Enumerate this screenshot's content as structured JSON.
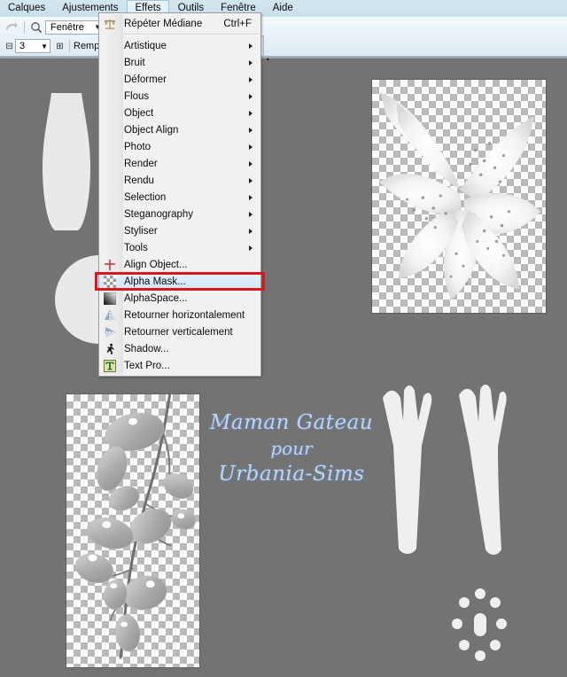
{
  "app": {
    "background_color": "#737373",
    "chrome_accent": "#c7dfeb"
  },
  "menubar": {
    "items": [
      {
        "label": "Calques",
        "active": false
      },
      {
        "label": "Ajustements",
        "active": false
      },
      {
        "label": "Effets",
        "active": true
      },
      {
        "label": "Outils",
        "active": false
      },
      {
        "label": "Fenêtre",
        "active": false
      },
      {
        "label": "Aide",
        "active": false
      }
    ]
  },
  "toolbar": {
    "row1": {
      "redo_icon": "redo-arrow-icon",
      "zoom_icon": "magnifier-icon",
      "zoom_mode_value": "Fenêtre",
      "caret": "▼"
    },
    "row2": {
      "minus_label": "⊟",
      "brush_size_value": "3",
      "plus_label": "⊞",
      "fill_label": "Rempl"
    },
    "overflow_caret": "▾"
  },
  "effets_menu": {
    "header_icon": "scales-balance-icon",
    "items": [
      {
        "label": "Répéter Médiane",
        "shortcut": "Ctrl+F",
        "submenu": false,
        "icon": "scales-balance-icon",
        "separator_after": true
      },
      {
        "label": "Artistique",
        "shortcut": "",
        "submenu": true,
        "icon": ""
      },
      {
        "label": "Bruit",
        "shortcut": "",
        "submenu": true,
        "icon": ""
      },
      {
        "label": "Déformer",
        "shortcut": "",
        "submenu": true,
        "icon": ""
      },
      {
        "label": "Flous",
        "shortcut": "",
        "submenu": true,
        "icon": ""
      },
      {
        "label": "Object",
        "shortcut": "",
        "submenu": true,
        "icon": ""
      },
      {
        "label": "Object Align",
        "shortcut": "",
        "submenu": true,
        "icon": ""
      },
      {
        "label": "Photo",
        "shortcut": "",
        "submenu": true,
        "icon": ""
      },
      {
        "label": "Render",
        "shortcut": "",
        "submenu": true,
        "icon": ""
      },
      {
        "label": "Rendu",
        "shortcut": "",
        "submenu": true,
        "icon": ""
      },
      {
        "label": "Selection",
        "shortcut": "",
        "submenu": true,
        "icon": ""
      },
      {
        "label": "Steganography",
        "shortcut": "",
        "submenu": true,
        "icon": ""
      },
      {
        "label": "Styliser",
        "shortcut": "",
        "submenu": true,
        "icon": ""
      },
      {
        "label": "Tools",
        "shortcut": "",
        "submenu": true,
        "icon": ""
      },
      {
        "label": "Align Object...",
        "shortcut": "",
        "submenu": false,
        "icon": "crosshair-plus-icon"
      },
      {
        "label": "Alpha Mask...",
        "shortcut": "",
        "submenu": false,
        "icon": "checker-swatch-icon",
        "highlighted": true
      },
      {
        "label": "AlphaSpace...",
        "shortcut": "",
        "submenu": false,
        "icon": "gradient-swatch-icon"
      },
      {
        "label": "Retourner horizontalement",
        "shortcut": "",
        "submenu": false,
        "icon": "flip-horizontal-icon"
      },
      {
        "label": "Retourner verticalement",
        "shortcut": "",
        "submenu": false,
        "icon": "flip-vertical-icon"
      },
      {
        "label": "Shadow...",
        "shortcut": "",
        "submenu": false,
        "icon": "running-figure-shadow-icon"
      },
      {
        "label": "Text Pro...",
        "shortcut": "",
        "submenu": false,
        "icon": "text-pro-icon"
      }
    ],
    "highlight_box_color": "#d8171e"
  },
  "canvas": {
    "signature": {
      "line1": "Maman Gateau",
      "line2": "pour",
      "line3": "Urbania-Sims",
      "color": "#c2d4e8"
    },
    "layers": [
      {
        "name": "vase-silhouette"
      },
      {
        "name": "circle-silhouette"
      },
      {
        "name": "lily-flower-image"
      },
      {
        "name": "leaves-branch-image"
      },
      {
        "name": "petal-shape-left"
      },
      {
        "name": "petal-shape-right"
      },
      {
        "name": "stamen-dots-cluster"
      }
    ]
  }
}
